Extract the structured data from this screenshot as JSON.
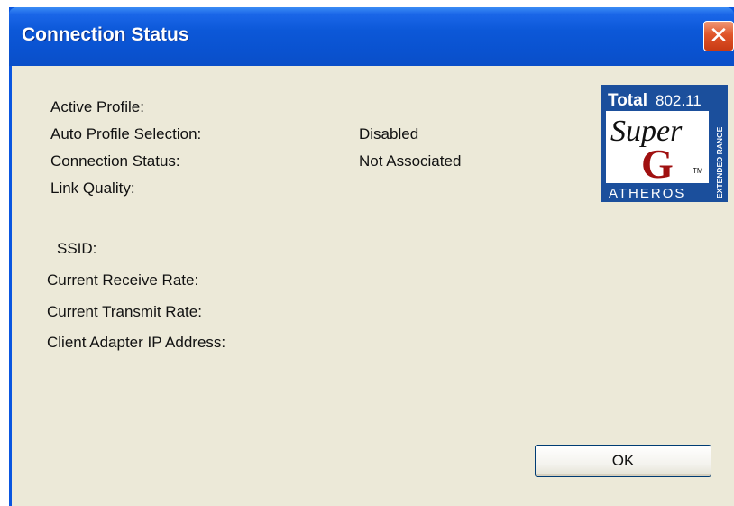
{
  "window": {
    "title": "Connection Status",
    "close_symbol": "✕"
  },
  "fields": {
    "active_profile": {
      "label": "Active Profile:",
      "value": ""
    },
    "auto_profile_selection": {
      "label": "Auto Profile Selection:",
      "value": "Disabled"
    },
    "connection_status": {
      "label": "Connection Status:",
      "value": "Not Associated"
    },
    "link_quality": {
      "label": "Link Quality:",
      "value": ""
    },
    "ssid": {
      "label": "SSID:",
      "value": ""
    },
    "current_receive_rate": {
      "label": "Current Receive Rate:",
      "value": ""
    },
    "current_transmit_rate": {
      "label": "Current Transmit Rate:",
      "value": ""
    },
    "client_adapter_ip": {
      "label": "Client Adapter IP Address:",
      "value": ""
    }
  },
  "logo": {
    "total": "Total",
    "standard": "802.11",
    "super": "Super",
    "g": "G",
    "tm": "TM",
    "brand": "ATHEROS",
    "side_text": "EXTENDED RANGE"
  },
  "buttons": {
    "ok_label": "OK"
  },
  "colors": {
    "titlebar": "#0a52d0",
    "close": "#e0552a",
    "client_bg": "#ece9d8",
    "logo_blue": "#1b4f9c",
    "logo_red": "#a01010"
  }
}
